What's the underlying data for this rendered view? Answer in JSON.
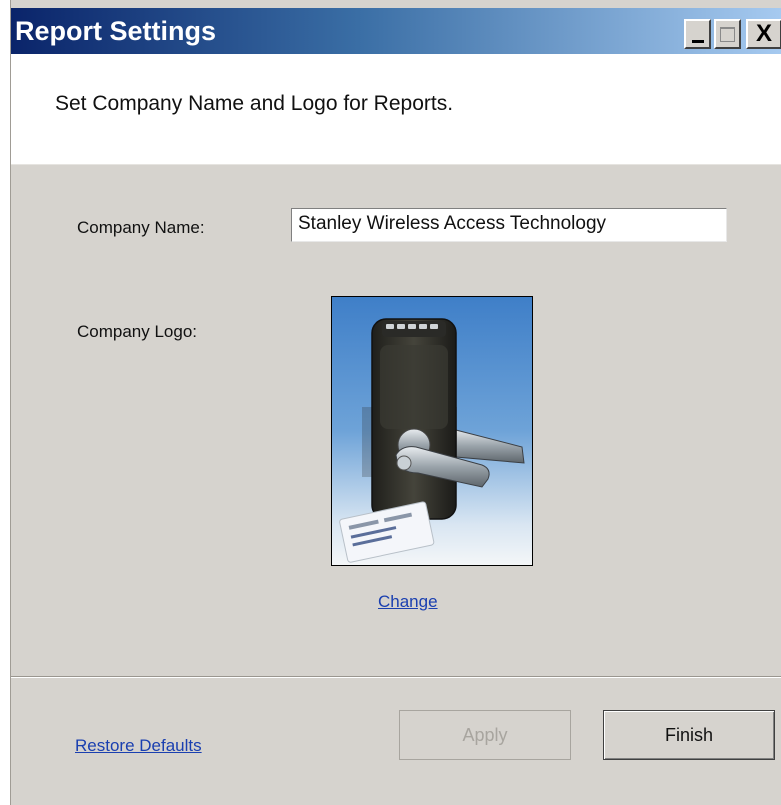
{
  "window": {
    "title": "Report Settings",
    "controls": {
      "minimize": "_",
      "close": "X"
    }
  },
  "header": {
    "instruction": "Set Company Name and Logo for Reports."
  },
  "form": {
    "company_name_label": "Company Name:",
    "company_name_value": "Stanley Wireless Access Technology",
    "company_logo_label": "Company Logo:",
    "change_link": "Change"
  },
  "footer": {
    "restore_defaults": "Restore Defaults",
    "apply": "Apply",
    "finish": "Finish",
    "apply_enabled": false
  },
  "colors": {
    "title_gradient_start": "#0a246a",
    "title_gradient_end": "#a6caf0",
    "dialog_background": "#d6d3ce",
    "link": "#1a3fb0",
    "disabled_text": "#a8a59f"
  },
  "icons": [
    "minimize-icon",
    "maximize-icon",
    "close-icon",
    "company-logo-image"
  ]
}
